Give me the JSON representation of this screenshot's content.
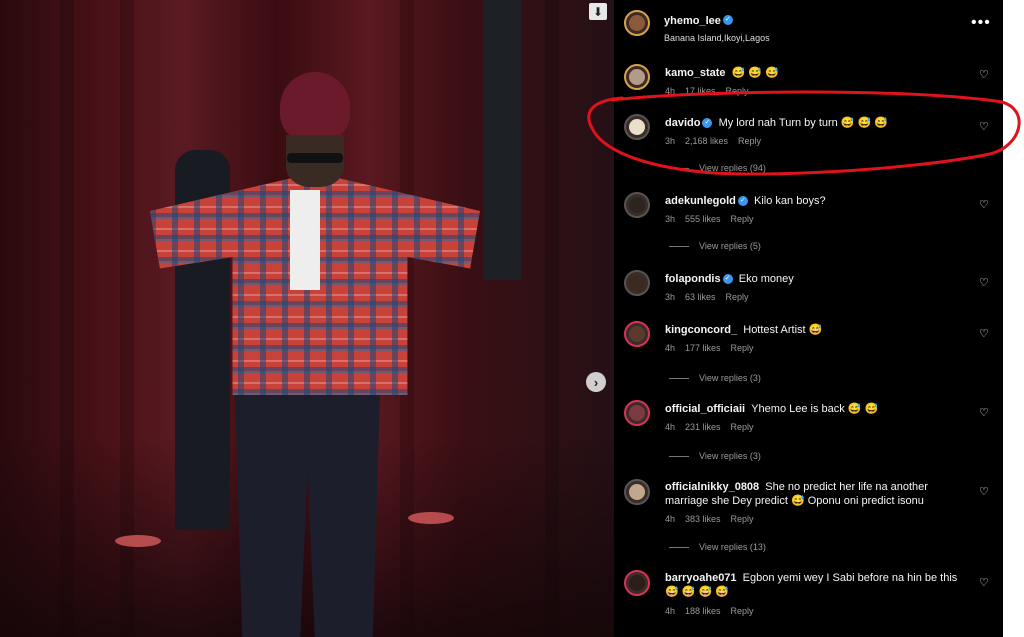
{
  "post": {
    "author": "yhemo_lee",
    "location": "Banana Island,Ikoyi,Lagos"
  },
  "icons": {
    "download": "download-arrow-icon",
    "next": "chevron-right-icon",
    "more": "more-options-icon",
    "heart": "heart-icon",
    "verified": "verified-badge-icon"
  },
  "colors": {
    "panel_bg": "#000000",
    "highlight_stroke": "#e0121c",
    "verified": "#3897f0"
  },
  "comments": [
    {
      "user": "kamo_state",
      "verified": false,
      "text": "😅 😅 😅",
      "time": "4h",
      "likes": "17 likes",
      "reply": "Reply",
      "view_replies": ""
    },
    {
      "user": "davido",
      "verified": true,
      "text": "My lord nah Turn by turn 😅 😅 😅",
      "time": "3h",
      "likes": "2,168 likes",
      "reply": "Reply",
      "view_replies": "View replies (94)"
    },
    {
      "user": "adekunlegold",
      "verified": true,
      "text": "Kilo kan boys?",
      "time": "3h",
      "likes": "555 likes",
      "reply": "Reply",
      "view_replies": "View replies (5)"
    },
    {
      "user": "folapondis",
      "verified": true,
      "text": "Eko money",
      "time": "3h",
      "likes": "63 likes",
      "reply": "Reply",
      "view_replies": ""
    },
    {
      "user": "kingconcord_",
      "verified": false,
      "text": "Hottest Artist 😅",
      "time": "4h",
      "likes": "177 likes",
      "reply": "Reply",
      "view_replies": "View replies (3)"
    },
    {
      "user": "official_officiaii",
      "verified": false,
      "text": "Yhemo Lee is back 😅 😅",
      "time": "4h",
      "likes": "231 likes",
      "reply": "Reply",
      "view_replies": "View replies (3)"
    },
    {
      "user": "officialnikky_0808",
      "verified": false,
      "text": "She no predict her life na another marriage she Dey predict 😅 Oponu oni predict isonu",
      "time": "4h",
      "likes": "383 likes",
      "reply": "Reply",
      "view_replies": "View replies (13)"
    },
    {
      "user": "barryoahe071",
      "verified": false,
      "text": "Egbon yemi wey I Sabi before na hin be this 😅 😅 😅 😅",
      "time": "4h",
      "likes": "188 likes",
      "reply": "Reply",
      "view_replies": ""
    }
  ]
}
